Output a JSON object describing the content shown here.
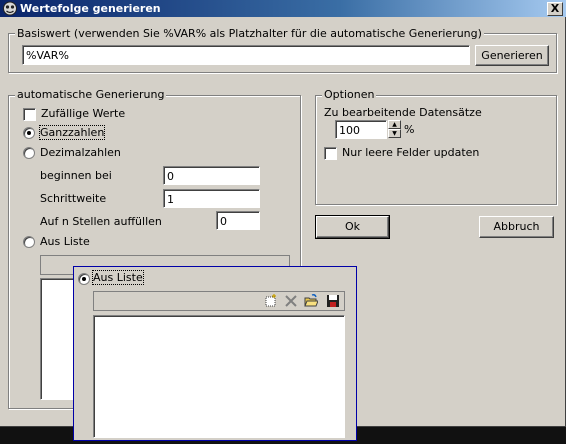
{
  "window": {
    "title": "Wertefolge generieren",
    "close_glyph": "X",
    "title_icon": "app-icon"
  },
  "basis": {
    "legend": "Basiswert (verwenden Sie %VAR% als Platzhalter für die automatische Generierung)",
    "value": "%VAR%",
    "generate_label": "Generieren"
  },
  "auto": {
    "legend": "automatische Generierung",
    "random_label": "Zufällige Werte",
    "random_checked": false,
    "integers_label": "Ganzzahlen",
    "integers_selected": true,
    "decimals_label": "Dezimalzahlen",
    "start_label": "beginnen bei",
    "start_value": "0",
    "step_label": "Schrittweite",
    "step_value": "1",
    "pad_label": "Auf n Stellen auffüllen",
    "pad_value": "0",
    "list_label": "Aus Liste",
    "list_items": []
  },
  "options": {
    "legend": "Optionen",
    "records_label": "Zu bearbeitende Datensätze",
    "records_value": "100",
    "records_unit": "%",
    "empty_only_label": "Nur leere Felder updaten",
    "empty_only_checked": false
  },
  "buttons": {
    "ok_label": "Ok",
    "cancel_label": "Abbruch"
  },
  "zoom_panel": {
    "list_label": "Aus Liste",
    "list_selected": true,
    "toolbar_icons": [
      "new-item-icon",
      "delete-icon",
      "open-folder-icon",
      "save-disk-icon"
    ]
  }
}
